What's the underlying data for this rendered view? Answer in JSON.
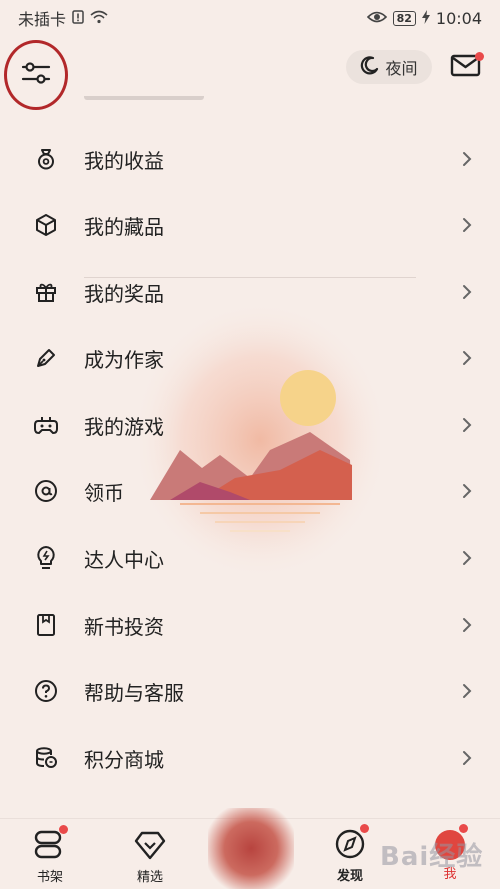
{
  "status": {
    "carrier": "未插卡",
    "battery": "82",
    "time": "10:04"
  },
  "header": {
    "night_label": "夜间"
  },
  "menu": [
    {
      "label": "我的收益",
      "icon": "coin-bag-icon"
    },
    {
      "label": "我的藏品",
      "icon": "cube-icon"
    },
    {
      "label": "我的奖品",
      "icon": "gift-icon"
    },
    {
      "label": "成为作家",
      "icon": "pen-icon"
    },
    {
      "label": "我的游戏",
      "icon": "gamepad-icon"
    },
    {
      "label": "领币",
      "icon": "at-coin-icon"
    },
    {
      "label": "达人中心",
      "icon": "lightbulb-icon"
    },
    {
      "label": "新书投资",
      "icon": "bookmark-icon"
    },
    {
      "label": "帮助与客服",
      "icon": "help-icon"
    },
    {
      "label": "积分商城",
      "icon": "coins-stack-icon"
    }
  ],
  "tabs": [
    {
      "label": "书架",
      "icon": "bookshelf-icon"
    },
    {
      "label": "精选",
      "icon": "diamond-icon"
    },
    {
      "label": "发现",
      "icon": "compass-icon"
    },
    {
      "label": "我",
      "icon": "avatar-icon"
    }
  ],
  "watermark": "Bai经验",
  "colors": {
    "background": "#f7ede8",
    "badge": "#e94a4a",
    "highlight_ring": "#b2282a"
  }
}
